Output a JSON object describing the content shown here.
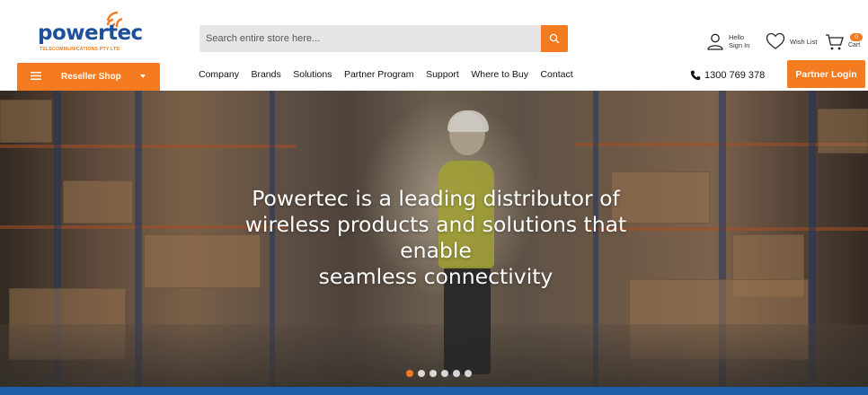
{
  "brand": {
    "name": "powertec",
    "tagline": "TELECOMMUNICATIONS PTY LTD",
    "primary_color": "#1d4f9c",
    "accent_color": "#f47b20"
  },
  "search": {
    "placeholder": "Search entire store here...",
    "button_icon": "search-icon"
  },
  "account": {
    "line1": "Hello",
    "line2": "Sign In",
    "icon": "user-icon"
  },
  "wishlist": {
    "label": "Wish List",
    "icon": "heart-icon"
  },
  "cart": {
    "count": "0",
    "label": "Cart",
    "icon": "cart-icon"
  },
  "reseller": {
    "label": "Reseller Shop",
    "icon": "menu-icon"
  },
  "nav": {
    "items": [
      "Company",
      "Brands",
      "Solutions",
      "Partner Program",
      "Support",
      "Where to Buy",
      "Contact"
    ]
  },
  "phone": {
    "number": "1300 769 378",
    "icon": "phone-icon"
  },
  "partner_login": {
    "label": "Partner Login"
  },
  "hero": {
    "lines": [
      "Powertec is a leading distributor of",
      "wireless products and solutions that",
      "enable",
      "seamless connectivity"
    ],
    "slides_total": 6,
    "active_slide": 1
  }
}
